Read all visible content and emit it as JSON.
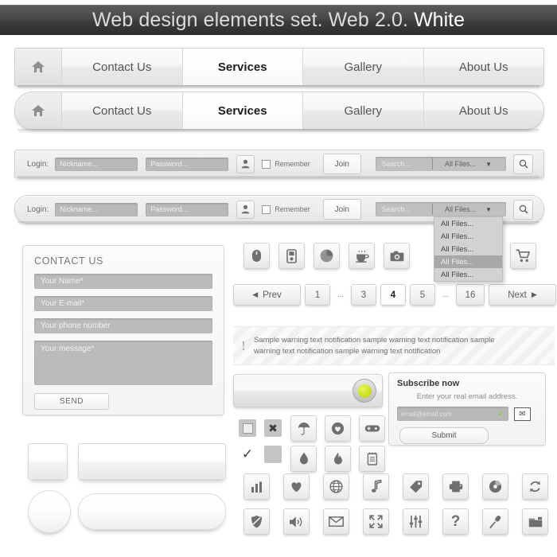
{
  "title": {
    "main": "Web design elements set. Web 2.0.",
    "accent": "White"
  },
  "nav_square": {
    "home_icon": "home-icon",
    "items": [
      {
        "label": "Contact Us",
        "active": false
      },
      {
        "label": "Services",
        "active": true
      },
      {
        "label": "Gallery",
        "active": false
      },
      {
        "label": "About Us",
        "active": false
      }
    ]
  },
  "nav_rounded": {
    "home_icon": "home-icon",
    "items": [
      {
        "label": "Contact Us",
        "active": false
      },
      {
        "label": "Services",
        "active": true
      },
      {
        "label": "Gallery",
        "active": false
      },
      {
        "label": "About Us",
        "active": false
      }
    ]
  },
  "login_bar_square": {
    "login_label": "Login:",
    "nickname_placeholder": "Nickname...",
    "password_placeholder": "Password...",
    "user_icon": "user-icon",
    "remember_label": "Remember",
    "join_label": "Join",
    "search_placeholder": "Search...",
    "filter_value": "All Files...",
    "caret_icon": "chevron-down-icon",
    "search_icon": "search-icon"
  },
  "login_bar_rounded": {
    "login_label": "Login:",
    "nickname_placeholder": "Nickname...",
    "password_placeholder": "Password...",
    "user_icon": "user-icon",
    "remember_label": "Remember",
    "join_label": "Join",
    "search_placeholder": "Search...",
    "filter_value": "All Files...",
    "caret_icon": "chevron-down-icon",
    "search_icon": "search-icon"
  },
  "dropdown": {
    "options": [
      {
        "label": "All Files...",
        "selected": false
      },
      {
        "label": "All Files...",
        "selected": false
      },
      {
        "label": "All Files...",
        "selected": false
      },
      {
        "label": "All Files...",
        "selected": true
      },
      {
        "label": "All Files...",
        "selected": false
      }
    ]
  },
  "contact_form": {
    "title": "CONTACT US",
    "name_placeholder": "Your Name*",
    "email_placeholder": "Your E-mail*",
    "phone_placeholder": "Your phone number",
    "message_placeholder": "Your message*",
    "send_label": "SEND"
  },
  "icon_row_top": {
    "icons": [
      "mouse-icon",
      "mobile-player-icon",
      "pie-chart-icon",
      "coffee-cup-icon",
      "camera-icon"
    ],
    "cart_icon": "shopping-cart-icon"
  },
  "pagination": {
    "prev_label": "Prev",
    "prev_icon": "triangle-left-icon",
    "next_label": "Next",
    "next_icon": "triangle-right-icon",
    "pages": [
      {
        "label": "1",
        "current": false,
        "ellipsis": false
      },
      {
        "label": "...",
        "current": false,
        "ellipsis": true
      },
      {
        "label": "3",
        "current": false,
        "ellipsis": false
      },
      {
        "label": "4",
        "current": true,
        "ellipsis": false
      },
      {
        "label": "5",
        "current": false,
        "ellipsis": false
      },
      {
        "label": "...",
        "current": false,
        "ellipsis": true
      },
      {
        "label": "16",
        "current": false,
        "ellipsis": false
      }
    ]
  },
  "warning": {
    "icon": "exclamation-icon",
    "text": "Sample warning text notification sample warning text notification sample warning text notification sample warning text notification"
  },
  "toggle": {
    "name": "toggle-switch",
    "knob_color": "#c8dd16",
    "state": "on"
  },
  "subscribe": {
    "heading": "Subscribe now",
    "subheading": "Enter your real email address.",
    "email_value": "email@email.com",
    "valid_icon": "check-icon",
    "mail_icon": "envelope-icon",
    "submit_label": "Submit"
  },
  "flat_icons": {
    "row1": [
      "stop-square-icon",
      "close-x-icon"
    ],
    "row2": [
      "check-mark-icon",
      "blank-square-icon"
    ]
  },
  "icon_grid_small": {
    "row1": [
      "umbrella-icon",
      "heart-badge-icon",
      "gamepad-icon"
    ],
    "row2": [
      "water-drop-icon",
      "flame-icon",
      "notepad-icon"
    ]
  },
  "icon_grid_large": {
    "row1": [
      "bar-chart-icon",
      "heart-icon",
      "globe-icon",
      "music-note-icon",
      "tag-icon",
      "printer-icon",
      "disc-icon",
      "refresh-icon"
    ],
    "row2": [
      "shield-icon",
      "speaker-icon",
      "envelope-icon",
      "fullscreen-icon",
      "sliders-icon",
      "question-icon",
      "microphone-icon",
      "folder-icon"
    ]
  },
  "blank_buttons": {
    "square": "blank-square-button",
    "bar": "blank-bar-button",
    "circle": "blank-circle-button",
    "pill": "blank-pill-button"
  },
  "colors": {
    "titlebar_dark": "#3c3c3c",
    "accent_green": "#c8dd16",
    "valid_green": "#7fd21a",
    "field_gray": "#bbbbbb"
  }
}
